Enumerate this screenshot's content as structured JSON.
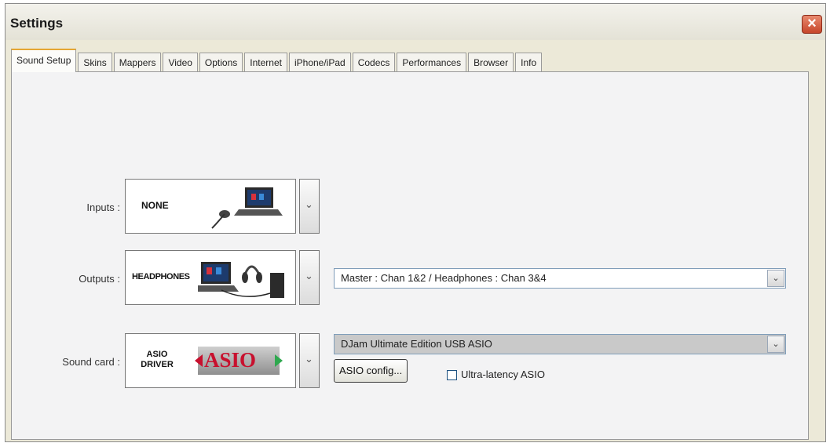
{
  "window": {
    "title": "Settings"
  },
  "tabs": [
    {
      "label": "Sound Setup",
      "active": true
    },
    {
      "label": "Skins",
      "active": false
    },
    {
      "label": "Mappers",
      "active": false
    },
    {
      "label": "Video",
      "active": false
    },
    {
      "label": "Options",
      "active": false
    },
    {
      "label": "Internet",
      "active": false
    },
    {
      "label": "iPhone/iPad",
      "active": false
    },
    {
      "label": "Codecs",
      "active": false
    },
    {
      "label": "Performances",
      "active": false
    },
    {
      "label": "Browser",
      "active": false
    },
    {
      "label": "Info",
      "active": false
    }
  ],
  "inputs": {
    "label": "Inputs :",
    "device_text": "NONE"
  },
  "outputs": {
    "label": "Outputs :",
    "device_text": "HEADPHONES",
    "routing_value": "Master : Chan 1&2 / Headphones : Chan 3&4"
  },
  "soundcard": {
    "label": "Sound card :",
    "device_text_line1": "ASIO",
    "device_text_line2": "DRIVER",
    "logo_text": "ASIO",
    "driver_value": "DJam Ultimate Edition USB ASIO",
    "config_button": "ASIO config...",
    "ultra_latency_label": "Ultra-latency ASIO",
    "ultra_latency_checked": false
  },
  "colors": {
    "tab_accent": "#e5a632",
    "close_red": "#c6452a",
    "asio_red": "#c8102e",
    "asio_green": "#2fa84f"
  }
}
